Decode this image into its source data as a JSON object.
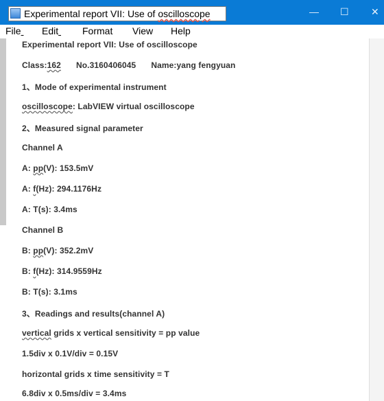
{
  "window": {
    "title": "Experimental report VII: Use of oscilloscope",
    "title_prefix": "Experimental report VII: Use of ",
    "title_spelled": "oscilloscope",
    "min_btn": "—",
    "max_btn": "☐",
    "close_btn": "✕"
  },
  "menu": {
    "file": "File",
    "edit": "Edit",
    "format": "Format",
    "view": "View",
    "help": "Help"
  },
  "report": {
    "heading": "Experimental report VII: Use of oscilloscope",
    "class_label": "Class:",
    "class_num": "162",
    "student_no": "No.3160406045",
    "name": "Name:yang fengyuan",
    "section1": "1、Mode of experimental instrument",
    "osc_word": "oscilloscope",
    "osc_rest": ": LabVIEW virtual oscilloscope",
    "section2": "2、Measured signal parameter",
    "channel_a": "Channel A",
    "a_pp_pre": "A: ",
    "a_pp_word": "pp",
    "a_pp_rest": "(V): 153.5mV",
    "a_f_pre": "A: ",
    "a_f_word": "f",
    "a_f_rest": "(Hz): 294.1176Hz",
    "a_t": "A: T(s): 3.4ms",
    "channel_b": "Channel B",
    "b_pp_pre": "B: ",
    "b_pp_word": "pp",
    "b_pp_rest": "(V): 352.2mV",
    "b_f_pre": "B: ",
    "b_f_word": "f",
    "b_f_rest": "(Hz): 314.9559Hz",
    "b_t": "B: T(s): 3.1ms",
    "section3": "3、Readings and results(channel A)",
    "vert_word": "vertical",
    "vert_rest": " grids x vertical sensitivity = pp value",
    "vert_calc": "1.5div x 0.1V/div = 0.15V",
    "horiz": "horizontal grids x time sensitivity = T",
    "horiz_calc": "6.8div x 0.5ms/div = 3.4ms"
  }
}
